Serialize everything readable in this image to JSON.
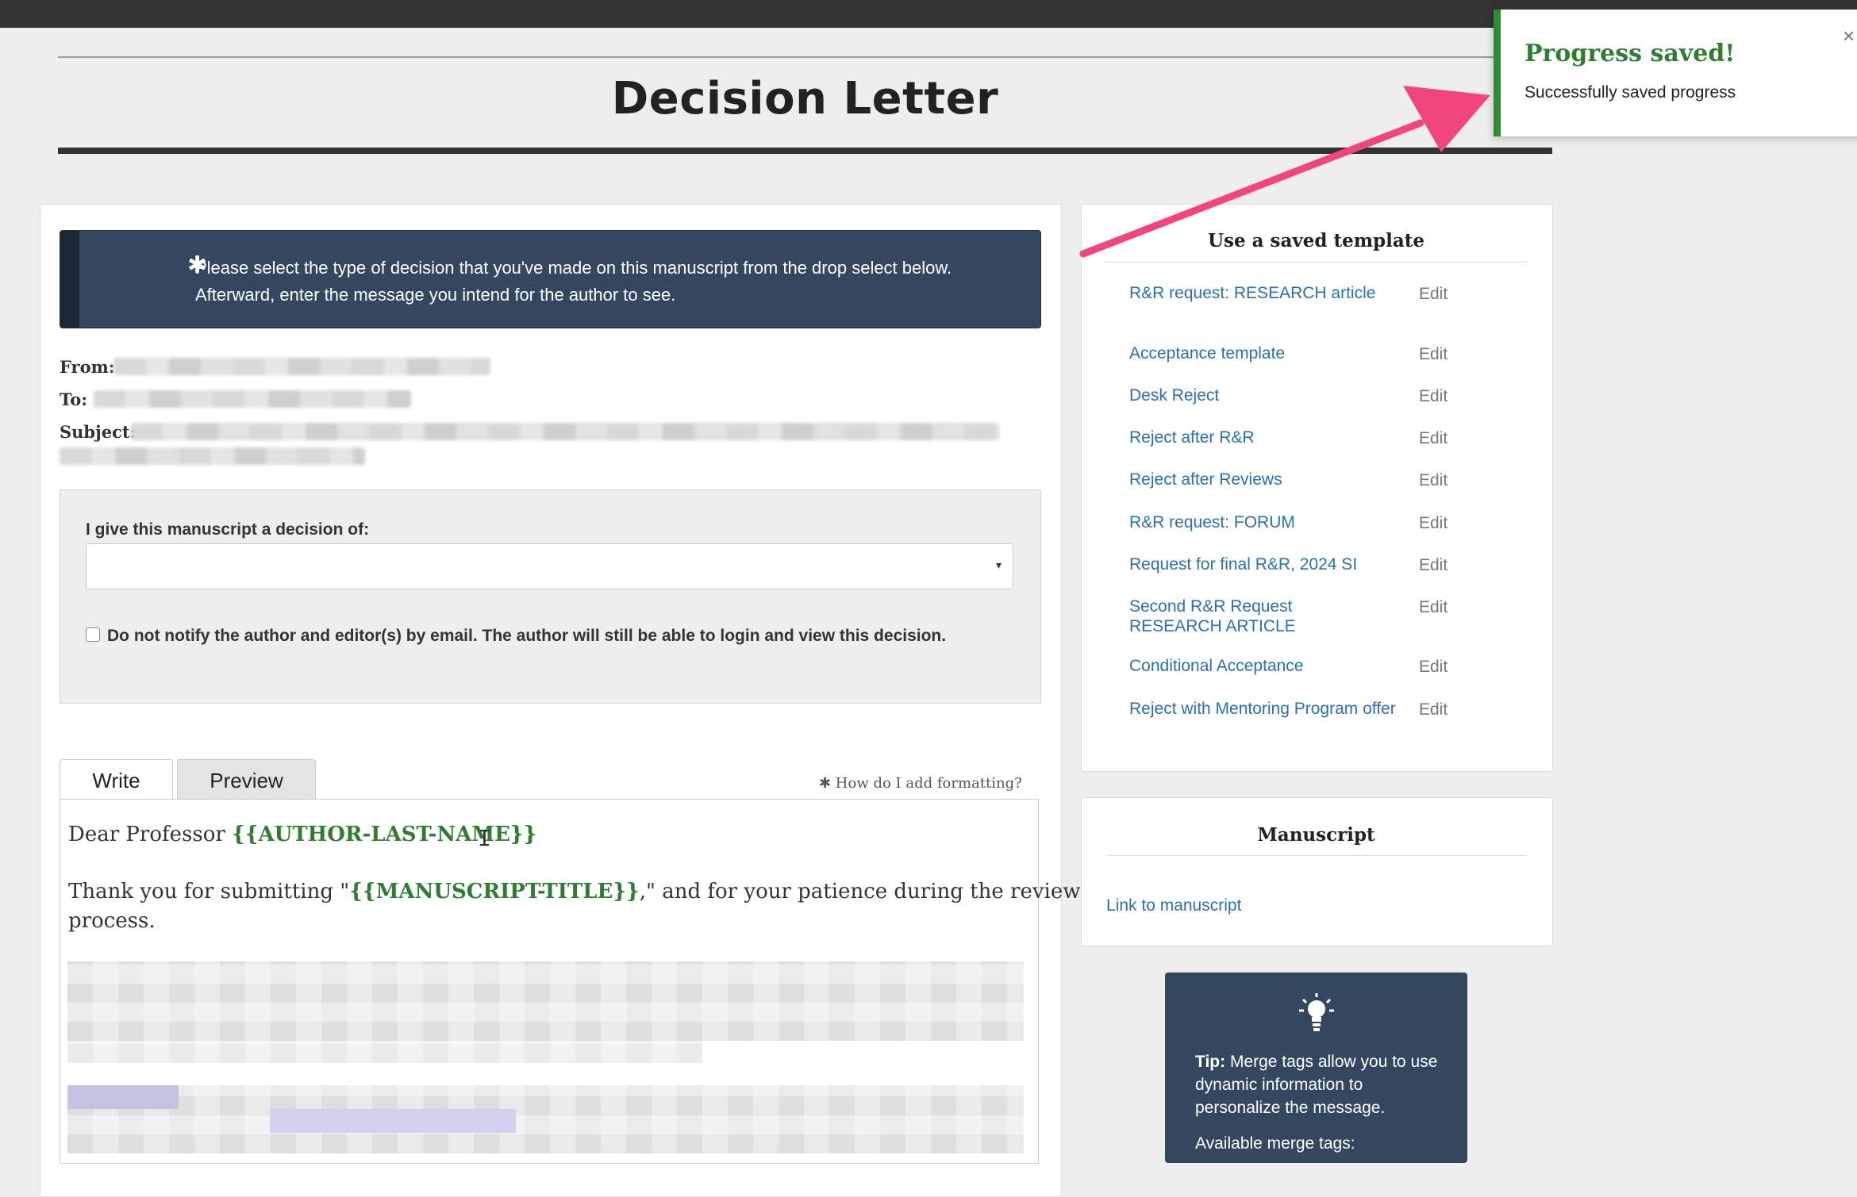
{
  "page": {
    "title": "Decision Letter"
  },
  "notice": {
    "star": "✱",
    "line1": "Please select the type of decision that you've made on this manuscript from the drop select below.",
    "line2": "Afterward, enter the message you intend for the author to see."
  },
  "meta": {
    "from_label": "From:",
    "to_label": "To:",
    "subject_label": "Subject:"
  },
  "decision": {
    "label": "I give this manuscript a decision of:",
    "selected": "",
    "notify_label": "Do not notify the author and editor(s) by email. The author will still be able to login and view this decision."
  },
  "tabs": {
    "write": "Write",
    "preview": "Preview"
  },
  "format_help": "✱ How do I add formatting?",
  "editor": {
    "greeting_prefix": "Dear Professor ",
    "author_tag": "{{AUTHOR-LAST-NAME}}",
    "thanks_prefix": "Thank you for submitting \"",
    "title_tag": "{{MANUSCRIPT-TITLE}}",
    "thanks_suffix": ",\" and for your patience during the review",
    "thanks_line2": "process."
  },
  "templates": {
    "title": "Use a saved template",
    "edit_label": "Edit",
    "items": [
      "R&R request: RESEARCH article",
      "Acceptance template",
      "Desk Reject",
      "Reject after R&R",
      "Reject after Reviews",
      "R&R request: FORUM",
      "Request for final R&R, 2024 SI",
      "Second R&R Request RESEARCH ARTICLE",
      "Conditional Acceptance",
      "Reject with Mentoring Program offer"
    ]
  },
  "manuscript": {
    "title": "Manuscript",
    "link": "Link to manuscript"
  },
  "tip": {
    "bold": "Tip:",
    "text": " Merge tags allow you to use dynamic information to personalize the message.",
    "merge_label": "Available merge tags:"
  },
  "toast": {
    "title": "Progress saved!",
    "message": "Successfully saved progress",
    "close": "×"
  },
  "colors": {
    "accent_green": "#2e7d32",
    "link_blue": "#2a6fb0",
    "notice_bg": "#34475f",
    "arrow": "#f0457d"
  }
}
